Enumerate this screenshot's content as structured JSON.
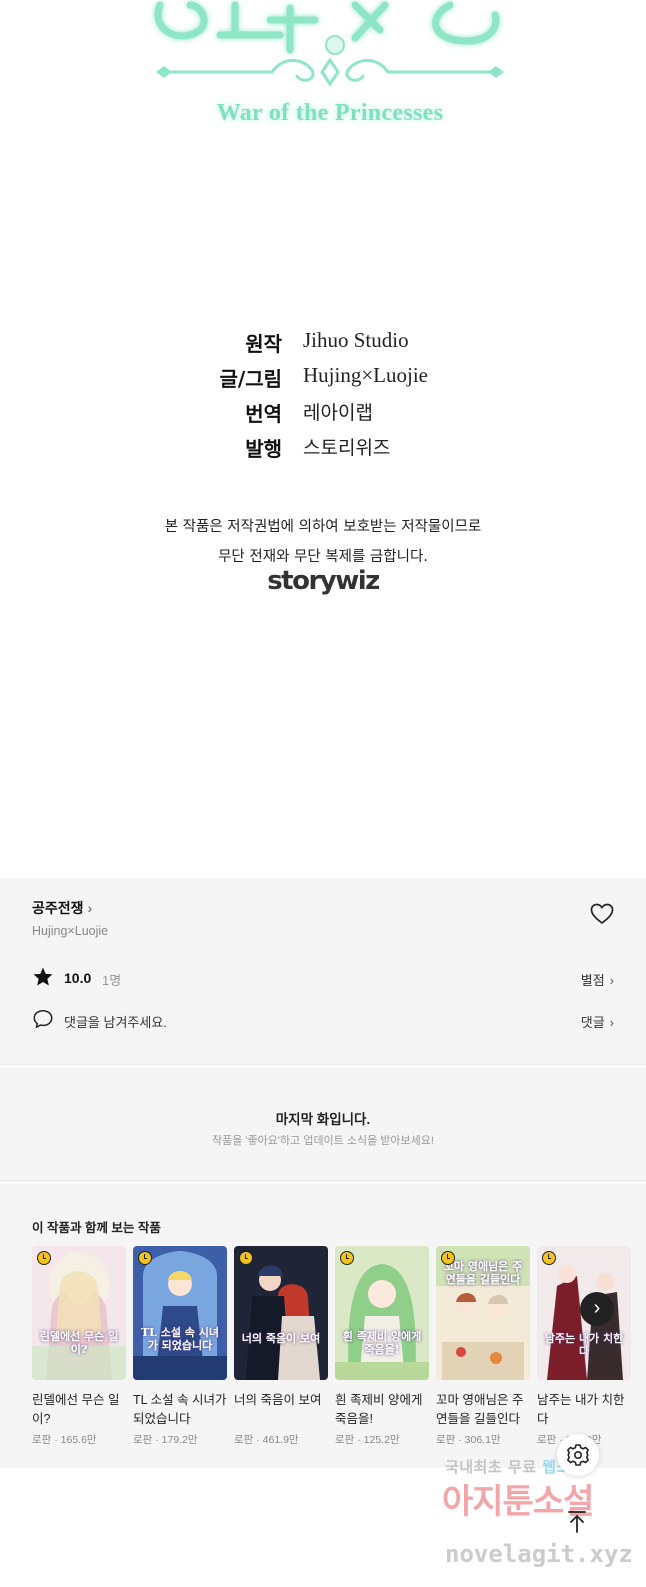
{
  "panel": {
    "logo_subtitle": "War of the Princesses",
    "credits": [
      {
        "label": "원작",
        "value": "Jihuo Studio"
      },
      {
        "label": "글/그림",
        "value": "Hujing×Luojie"
      },
      {
        "label": "번역",
        "value": "레아이랩"
      },
      {
        "label": "발행",
        "value": "스토리위즈"
      }
    ],
    "copyright_line1": "본 작품은 저작권법에 의하여 보호받는 저작물이므로",
    "copyright_line2": "무단 전재와 무단 복제를 금합니다.",
    "brand": "storywiz"
  },
  "series": {
    "title": "공주전쟁",
    "author": "Hujing×Luojie",
    "rating": "10.0",
    "rating_count": "1명",
    "rating_link": "별점",
    "comment_prompt": "댓글을 남겨주세요.",
    "comment_link": "댓글",
    "chevron": "›"
  },
  "last_episode": {
    "title": "마지막 화입니다.",
    "subtitle": "작품을 '좋아요'하고 업데이트 소식을 받아보세요!"
  },
  "recommendations": {
    "title": "이 작품과 함께 보는 작품",
    "items": [
      {
        "title": "린델에선 무슨 일이?",
        "meta": "로판 · 165.6만",
        "cover_text": "린델에선 무슨 일이?"
      },
      {
        "title": "TL 소설 속 시녀가 되었습니다",
        "meta": "로판 · 179.2만",
        "cover_text": "TL 소설 속 시녀가 되었습니다"
      },
      {
        "title": "너의 죽음이 보여",
        "meta": "로판 · 461.9만",
        "cover_text": "너의 죽음이 보여"
      },
      {
        "title": "흰 족제비 양에게 죽음을!",
        "meta": "로판 · 125.2만",
        "cover_text": "흰 족제비 양에게 죽음을!"
      },
      {
        "title": "꼬마 영애님은 주연들을 길들인다",
        "meta": "로판 · 306.1만",
        "cover_text": "꼬마 영애님은 주연들을 길들인다"
      },
      {
        "title": "남주는 내가 치한다",
        "meta": "로판 · 263.9만",
        "cover_text": "남주는 내가 치한다"
      }
    ]
  },
  "watermark": {
    "line1_a": "국내최초 무료 ",
    "line1_b": "웹소설",
    "line2": "아지툰소설",
    "line3": "novelagit.xyz"
  },
  "colors": {
    "logo_green": "#7fe0bf",
    "section_bg": "#f5f5f5",
    "clock_badge": "#f3c21b"
  }
}
